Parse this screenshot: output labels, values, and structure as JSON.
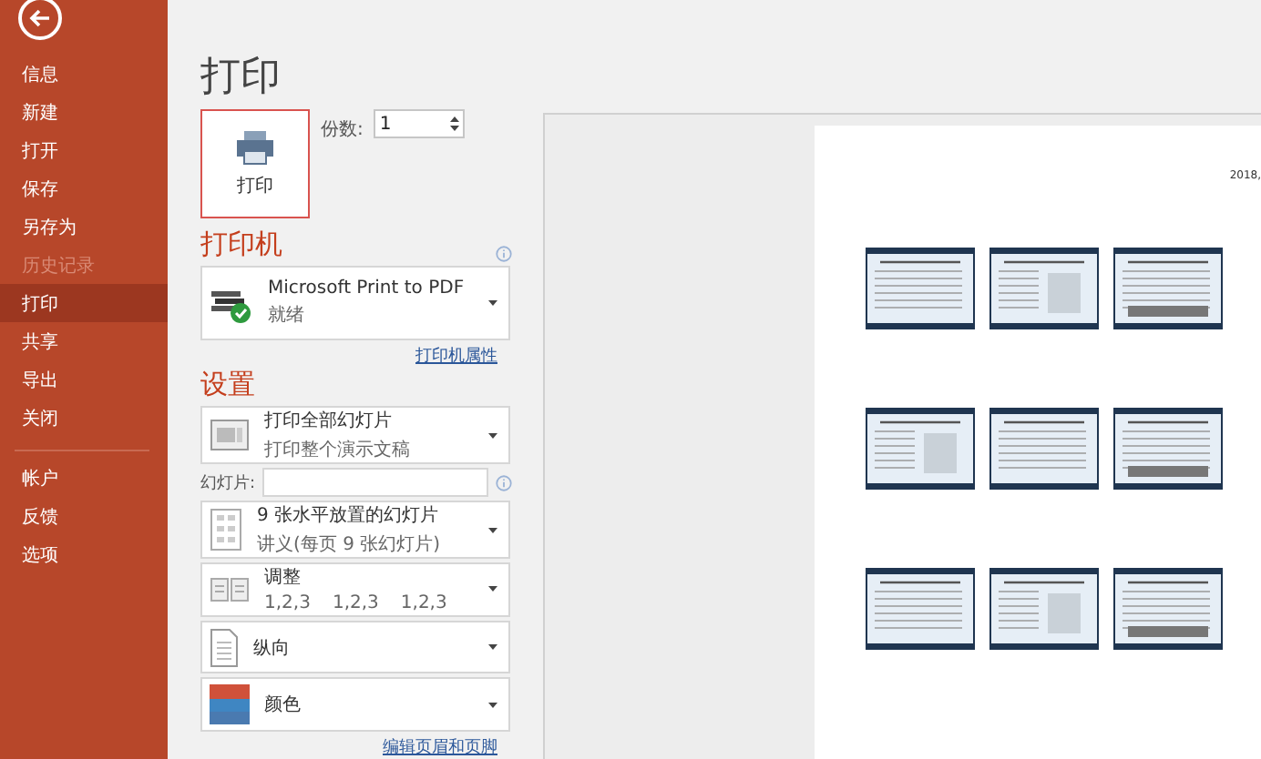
{
  "sidebar": {
    "items": [
      {
        "label": "信息",
        "selected": false,
        "disabled": false
      },
      {
        "label": "新建",
        "selected": false,
        "disabled": false
      },
      {
        "label": "打开",
        "selected": false,
        "disabled": false
      },
      {
        "label": "保存",
        "selected": false,
        "disabled": false
      },
      {
        "label": "另存为",
        "selected": false,
        "disabled": false
      },
      {
        "label": "历史记录",
        "selected": false,
        "disabled": true
      },
      {
        "label": "打印",
        "selected": true,
        "disabled": false
      },
      {
        "label": "共享",
        "selected": false,
        "disabled": false
      },
      {
        "label": "导出",
        "selected": false,
        "disabled": false
      },
      {
        "label": "关闭",
        "selected": false,
        "disabled": false
      }
    ],
    "footer_items": [
      {
        "label": "帐户",
        "selected": false,
        "disabled": false
      },
      {
        "label": "反馈",
        "selected": false,
        "disabled": false
      },
      {
        "label": "选项",
        "selected": false,
        "disabled": false
      }
    ]
  },
  "title": "打印",
  "print_button": "打印",
  "copies": {
    "label": "份数:",
    "value": "1"
  },
  "printer": {
    "heading": "打印机",
    "name": "Microsoft Print to PDF",
    "status": "就绪",
    "link": "打印机属性"
  },
  "settings": {
    "heading": "设置",
    "dropdowns": [
      {
        "kind": "all-slides",
        "title": "打印全部幻灯片",
        "subtitle": [
          "打印整个演示文稿"
        ]
      },
      {
        "kind": "handout",
        "title": "9 张水平放置的幻灯片",
        "subtitle": [
          "讲义(每页 9 张幻灯片)"
        ]
      },
      {
        "kind": "collate",
        "title": "调整",
        "subtitle": [
          "1,2,3",
          "1,2,3",
          "1,2,3"
        ]
      },
      {
        "kind": "portrait",
        "title": "纵向"
      },
      {
        "kind": "color",
        "title": "颜色"
      }
    ],
    "slides_field": {
      "label": "幻灯片:"
    },
    "link": "编辑页眉和页脚"
  },
  "preview": {
    "date": "2018,"
  }
}
